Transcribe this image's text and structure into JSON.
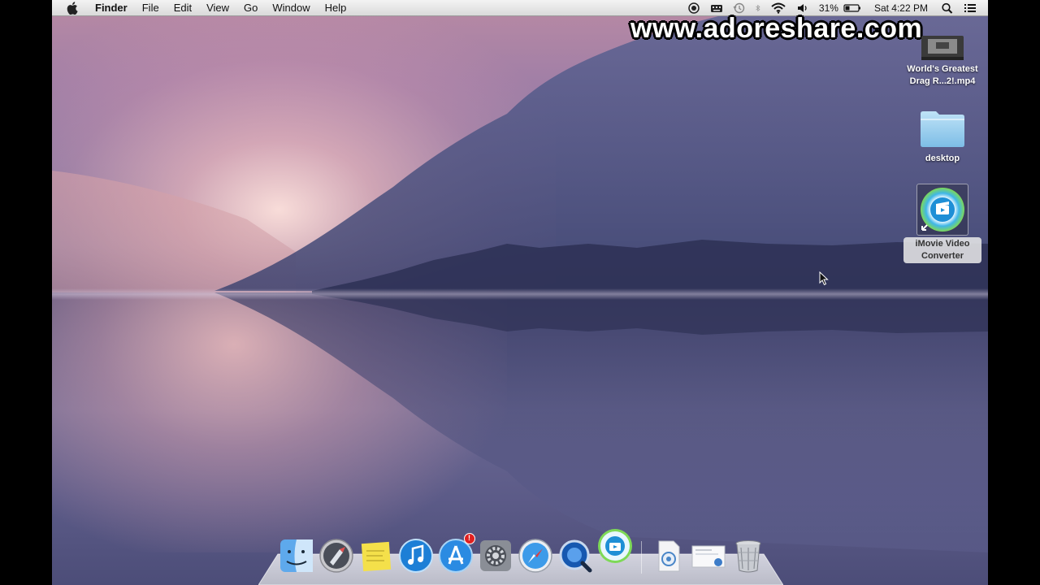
{
  "menubar": {
    "app_name": "Finder",
    "menus": [
      "File",
      "Edit",
      "View",
      "Go",
      "Window",
      "Help"
    ],
    "status": {
      "battery_percent": "31%",
      "clock": "Sat 4:22 PM"
    },
    "icons": [
      "apple-icon",
      "record-icon",
      "keyboard-icon",
      "time-machine-icon",
      "bluetooth-icon",
      "wifi-icon",
      "volume-icon",
      "battery-icon",
      "spotlight-icon",
      "notification-center-icon"
    ]
  },
  "watermark": "www.adoreshare.com",
  "desktop_items": [
    {
      "label": "World's Greatest Drag R...2!.mp4",
      "icon": "video-file-icon"
    },
    {
      "label": "desktop",
      "icon": "folder-icon"
    },
    {
      "label": "iMovie Video Converter",
      "icon": "imovie-converter-alias-icon",
      "selected": true
    }
  ],
  "dock": {
    "apps": [
      "finder-icon",
      "launchpad-icon",
      "stickies-icon",
      "itunes-icon",
      "app-store-icon",
      "system-preferences-icon",
      "safari-icon",
      "quicktime-icon",
      "imovie-converter-icon"
    ],
    "app_store_badge": "!",
    "others": [
      "downloads-stack-icon",
      "documents-stack-icon",
      "trash-icon"
    ]
  }
}
